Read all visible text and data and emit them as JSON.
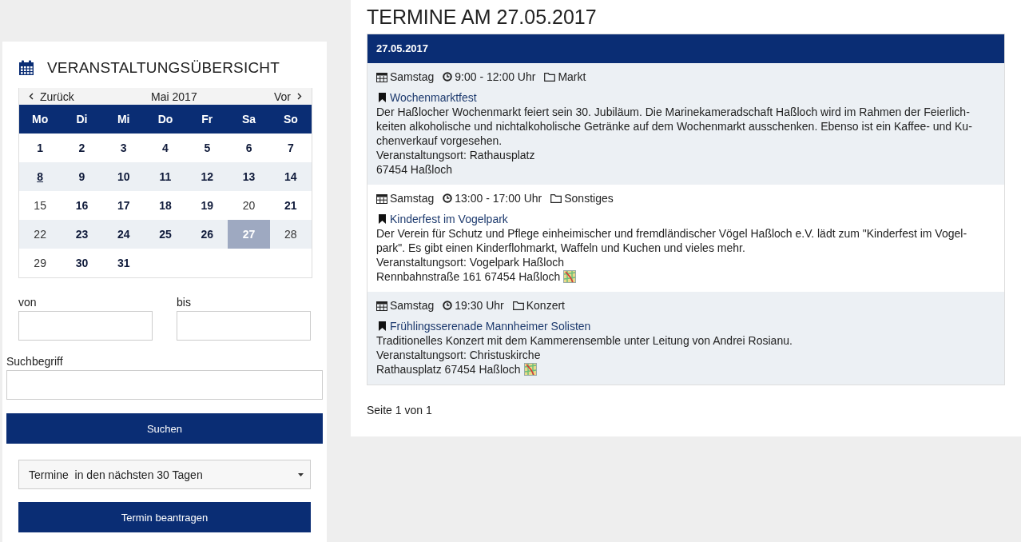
{
  "sidebar": {
    "title": "VERANSTALTUNGSÜBERSICHT",
    "calendar": {
      "prev": "Zurück",
      "month": "Mai 2017",
      "next": "Vor",
      "weekdays": [
        "Mo",
        "Di",
        "Mi",
        "Do",
        "Fr",
        "Sa",
        "So"
      ],
      "weeks": [
        [
          {
            "label": "1",
            "events": true,
            "today": false,
            "selected": false
          },
          {
            "label": "2",
            "events": true,
            "today": false,
            "selected": false
          },
          {
            "label": "3",
            "events": true,
            "today": false,
            "selected": false
          },
          {
            "label": "4",
            "events": true,
            "today": false,
            "selected": false
          },
          {
            "label": "5",
            "events": true,
            "today": false,
            "selected": false
          },
          {
            "label": "6",
            "events": true,
            "today": false,
            "selected": false
          },
          {
            "label": "7",
            "events": true,
            "today": false,
            "selected": false
          }
        ],
        [
          {
            "label": "8",
            "events": true,
            "today": true,
            "selected": false
          },
          {
            "label": "9",
            "events": true,
            "today": false,
            "selected": false
          },
          {
            "label": "10",
            "events": true,
            "today": false,
            "selected": false
          },
          {
            "label": "11",
            "events": true,
            "today": false,
            "selected": false
          },
          {
            "label": "12",
            "events": true,
            "today": false,
            "selected": false
          },
          {
            "label": "13",
            "events": true,
            "today": false,
            "selected": false
          },
          {
            "label": "14",
            "events": true,
            "today": false,
            "selected": false
          }
        ],
        [
          {
            "label": "15",
            "events": false,
            "today": false,
            "selected": false
          },
          {
            "label": "16",
            "events": true,
            "today": false,
            "selected": false
          },
          {
            "label": "17",
            "events": true,
            "today": false,
            "selected": false
          },
          {
            "label": "18",
            "events": true,
            "today": false,
            "selected": false
          },
          {
            "label": "19",
            "events": true,
            "today": false,
            "selected": false
          },
          {
            "label": "20",
            "events": false,
            "today": false,
            "selected": false
          },
          {
            "label": "21",
            "events": true,
            "today": false,
            "selected": false
          }
        ],
        [
          {
            "label": "22",
            "events": false,
            "today": false,
            "selected": false
          },
          {
            "label": "23",
            "events": true,
            "today": false,
            "selected": false
          },
          {
            "label": "24",
            "events": true,
            "today": false,
            "selected": false
          },
          {
            "label": "25",
            "events": true,
            "today": false,
            "selected": false
          },
          {
            "label": "26",
            "events": true,
            "today": false,
            "selected": false
          },
          {
            "label": "27",
            "events": true,
            "today": false,
            "selected": true
          },
          {
            "label": "28",
            "events": false,
            "today": false,
            "selected": false
          }
        ],
        [
          {
            "label": "29",
            "events": false,
            "today": false,
            "selected": false
          },
          {
            "label": "30",
            "events": true,
            "today": false,
            "selected": false
          },
          {
            "label": "31",
            "events": true,
            "today": false,
            "selected": false
          }
        ]
      ]
    },
    "from_label": "von",
    "to_label": "bis",
    "search_label": "Suchbegriff",
    "search_button": "Suchen",
    "range_select": "Termine  in den nächsten 30 Tagen",
    "request_button": "Termin beantragen"
  },
  "main": {
    "title": "TERMINE AM 27.05.2017",
    "date_header": "27.05.2017",
    "events": [
      {
        "day": "Samstag",
        "time": "9:00 - 12:00 Uhr",
        "category": "Markt",
        "title": "Wochenmarktfest",
        "description": [
          "Der Haßlocher Wochenmarkt feiert sein 30. Jubiläum. Die Marinekameradschaft Haßloch wird im Rahmen der Feierlich-",
          "keiten alkoholische und nichtalkoholische Getränke auf dem Wochenmarkt ausschenken. Ebenso ist ein Kaffee- und Ku-",
          "chenverkauf vorgesehen."
        ],
        "venue": "Veranstaltungsort: Rathausplatz",
        "address": "67454 Haßloch",
        "map": false
      },
      {
        "day": "Samstag",
        "time": "13:00 - 17:00 Uhr",
        "category": "Sonstiges",
        "title": "Kinderfest im Vogelpark",
        "description": [
          "Der Verein für Schutz und Pflege einheimischer und fremdländischer Vögel Haßloch e.V. lädt zum \"Kinderfest im Vogel-",
          "park\". Es gibt einen Kinderflohmarkt, Waffeln und Kuchen und vieles mehr."
        ],
        "venue": "Veranstaltungsort: Vogelpark Haßloch",
        "address": "Rennbahnstraße 161 67454 Haßloch",
        "map": true
      },
      {
        "day": "Samstag",
        "time": "19:30 Uhr",
        "category": "Konzert",
        "title": "Frühlingsserenade Mannheimer Solisten",
        "description": [
          "Traditionelles Konzert mit dem Kammerensemble unter Leitung von Andrei Rosianu."
        ],
        "venue": "Veranstaltungsort: Christuskirche",
        "address": "Rathausplatz 67454 Haßloch",
        "map": true
      }
    ],
    "pagination": "Seite 1 von 1"
  }
}
